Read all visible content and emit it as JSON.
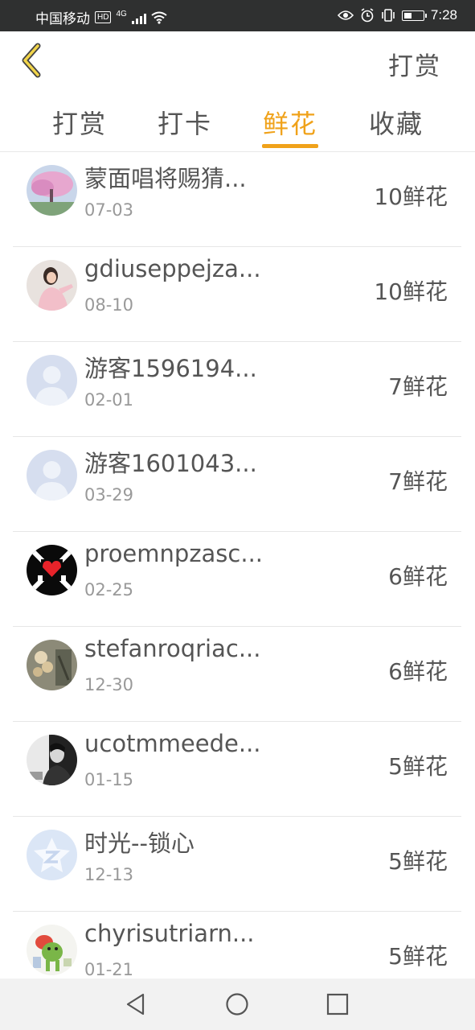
{
  "status_bar": {
    "carrier": "中国移动",
    "hd": "HD",
    "network": "4G",
    "time": "7:28"
  },
  "header": {
    "back_icon": "chevron-left-icon",
    "action_label": "打赏"
  },
  "tabs": [
    {
      "label": "打赏",
      "active": false
    },
    {
      "label": "打卡",
      "active": false
    },
    {
      "label": "鲜花",
      "active": true
    },
    {
      "label": "收藏",
      "active": false
    }
  ],
  "accent_color": "#f0a21a",
  "list": [
    {
      "name": "蒙面唱将赐猜...",
      "date": "07-03",
      "amount": "10鲜花",
      "avatar": "photo-pink-tree"
    },
    {
      "name": "gdiuseppejza...",
      "date": "08-10",
      "amount": "10鲜花",
      "avatar": "photo-person"
    },
    {
      "name": "游客1596194...",
      "date": "02-01",
      "amount": "7鲜花",
      "avatar": "default-user"
    },
    {
      "name": "游客1601043...",
      "date": "03-29",
      "amount": "7鲜花",
      "avatar": "default-user"
    },
    {
      "name": "proemnpzasc...",
      "date": "02-25",
      "amount": "6鲜花",
      "avatar": "black-heart-logo"
    },
    {
      "name": "stefanroqriac...",
      "date": "12-30",
      "amount": "6鲜花",
      "avatar": "photo-flowers"
    },
    {
      "name": "ucotmmeede...",
      "date": "01-15",
      "amount": "5鲜花",
      "avatar": "photo-bw-person"
    },
    {
      "name": "时光--锁心",
      "date": "12-13",
      "amount": "5鲜花",
      "avatar": "qzone-logo"
    },
    {
      "name": "chyrisutriarn...",
      "date": "01-21",
      "amount": "5鲜花",
      "avatar": "cartoon-frog"
    }
  ],
  "nav": {
    "back": "triangle-back-icon",
    "home": "circle-home-icon",
    "recent": "square-recent-icon"
  }
}
